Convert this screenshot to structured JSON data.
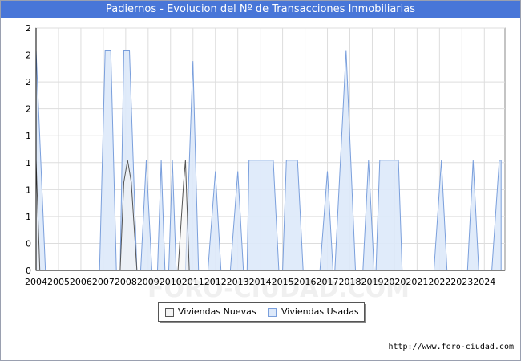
{
  "title": "Padiernos - Evolucion del Nº de Transacciones Inmobiliarias",
  "footer_url": "http://www.foro-ciudad.com",
  "watermark": "FORO-CIUDAD.COM",
  "colors": {
    "title_bg": "#4876d8",
    "nuevas_fill": "#f4f4f4",
    "nuevas_stroke": "#555555",
    "usadas_fill": "#dde9fa",
    "usadas_stroke": "#7a9fdc",
    "grid": "#dddddd"
  },
  "chart_data": {
    "type": "area",
    "title": "Padiernos - Evolucion del Nº de Transacciones Inmobiliarias",
    "xlabel": "",
    "ylabel": "",
    "x_ticks": [
      "2004",
      "2005",
      "2006",
      "2007",
      "2008",
      "2009",
      "2010",
      "2011",
      "2012",
      "2013",
      "2014",
      "2015",
      "2016",
      "2017",
      "2018",
      "2019",
      "2020",
      "2021",
      "2022",
      "2023",
      "2024"
    ],
    "y_ticks": [
      "0",
      "0",
      "1",
      "1",
      "1",
      "1",
      "2",
      "2",
      "2",
      "2"
    ],
    "ylim": [
      0,
      2.2
    ],
    "grid": true,
    "legend_position": "bottom",
    "series": [
      {
        "name": "Viviendas Nuevas",
        "points": [
          [
            "2004-01",
            1
          ],
          [
            "2004-03",
            0
          ],
          [
            "2007-10",
            0
          ],
          [
            "2007-12",
            0.8
          ],
          [
            "2008-02",
            1
          ],
          [
            "2008-04",
            0.8
          ],
          [
            "2008-07",
            0
          ],
          [
            "2010-05",
            0
          ],
          [
            "2010-08",
            0.8
          ],
          [
            "2010-09",
            1
          ],
          [
            "2010-11",
            0
          ]
        ]
      },
      {
        "name": "Viviendas Usadas",
        "points": [
          [
            "2004-01",
            2
          ],
          [
            "2004-06",
            0
          ],
          [
            "2006-11",
            0
          ],
          [
            "2007-02",
            2
          ],
          [
            "2007-05",
            2
          ],
          [
            "2007-08",
            0
          ],
          [
            "2007-10",
            0
          ],
          [
            "2007-12",
            2
          ],
          [
            "2008-03",
            2
          ],
          [
            "2008-07",
            0
          ],
          [
            "2008-09",
            0
          ],
          [
            "2008-12",
            1
          ],
          [
            "2009-03",
            0
          ],
          [
            "2009-06",
            0
          ],
          [
            "2009-08",
            1
          ],
          [
            "2009-10",
            0
          ],
          [
            "2009-12",
            0
          ],
          [
            "2010-02",
            1
          ],
          [
            "2010-04",
            0
          ],
          [
            "2010-09",
            0
          ],
          [
            "2011-01",
            1.9
          ],
          [
            "2011-04",
            0
          ],
          [
            "2011-09",
            0
          ],
          [
            "2012-01",
            0.9
          ],
          [
            "2012-04",
            0
          ],
          [
            "2012-09",
            0
          ],
          [
            "2013-01",
            0.9
          ],
          [
            "2013-04",
            0
          ],
          [
            "2013-06",
            0
          ],
          [
            "2013-07",
            1
          ],
          [
            "2014-08",
            1
          ],
          [
            "2014-11",
            0
          ],
          [
            "2015-01",
            0
          ],
          [
            "2015-03",
            1
          ],
          [
            "2015-09",
            1
          ],
          [
            "2015-12",
            0
          ],
          [
            "2016-09",
            0
          ],
          [
            "2017-01",
            0.9
          ],
          [
            "2017-04",
            0
          ],
          [
            "2017-05",
            0
          ],
          [
            "2017-11",
            2
          ],
          [
            "2018-04",
            0
          ],
          [
            "2018-08",
            0
          ],
          [
            "2018-11",
            1
          ],
          [
            "2019-02",
            0
          ],
          [
            "2019-03",
            0
          ],
          [
            "2019-05",
            1
          ],
          [
            "2020-03",
            1
          ],
          [
            "2020-05",
            0
          ],
          [
            "2021-10",
            0
          ],
          [
            "2022-02",
            1
          ],
          [
            "2022-05",
            0
          ],
          [
            "2023-04",
            0
          ],
          [
            "2023-07",
            1
          ],
          [
            "2023-10",
            0
          ],
          [
            "2024-05",
            0
          ],
          [
            "2024-09",
            1
          ],
          [
            "2024-10",
            1
          ]
        ]
      }
    ]
  }
}
